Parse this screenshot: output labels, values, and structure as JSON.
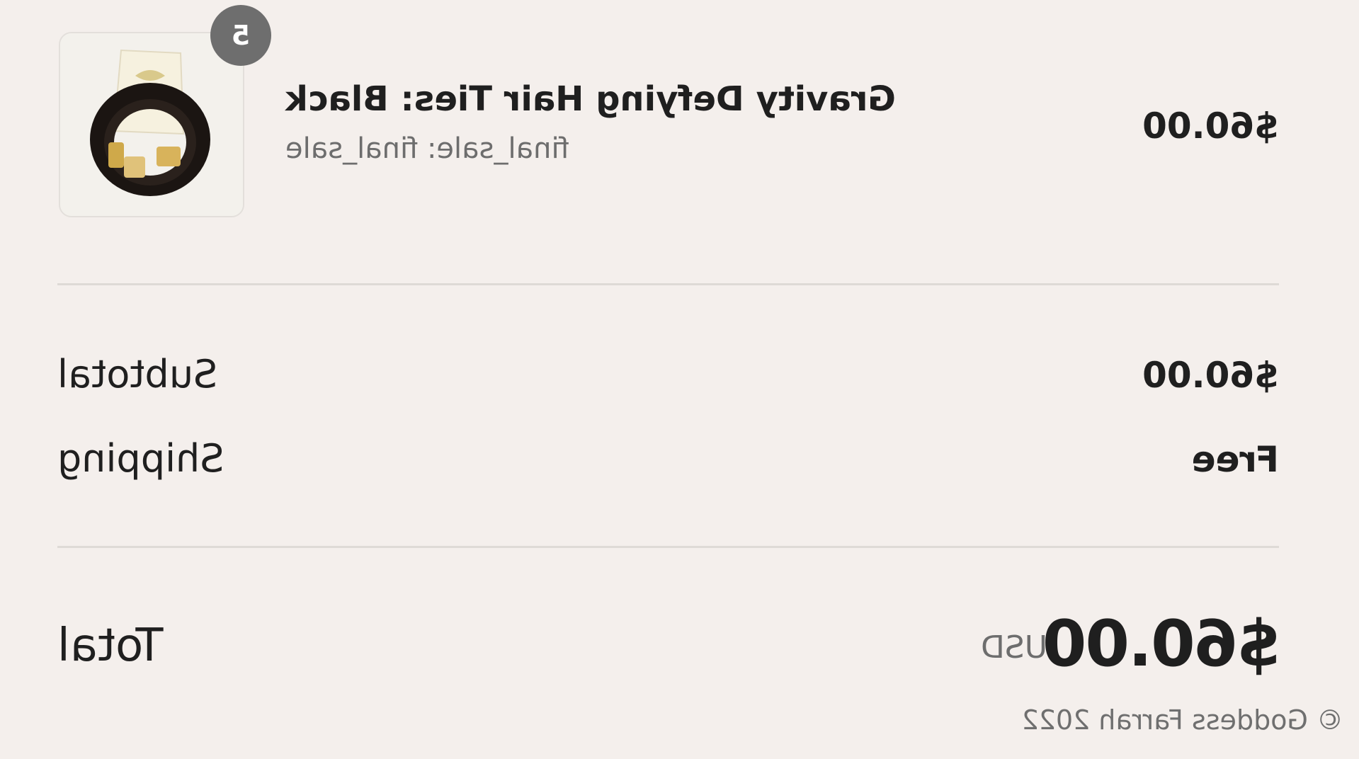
{
  "cart_item": {
    "quantity": "5",
    "title": "Gravity Defying Hair Ties: Black",
    "variant": "final_sale: final_sale",
    "price": "$60.00",
    "image_icon": "hair-ties-product-image"
  },
  "summary": {
    "subtotal_label": "Subtotal",
    "subtotal_value": "$60.00",
    "shipping_label": "Shipping",
    "shipping_value": "Free",
    "total_label": "Total",
    "total_currency": "USD",
    "total_value": "$60.00"
  },
  "footer": {
    "copyright": "© Goddess Farrah 2022"
  },
  "colors": {
    "background": "#f4efec",
    "badge": "#6e6e6e",
    "text": "#1f1f1f",
    "muted": "#6d6d6d"
  }
}
